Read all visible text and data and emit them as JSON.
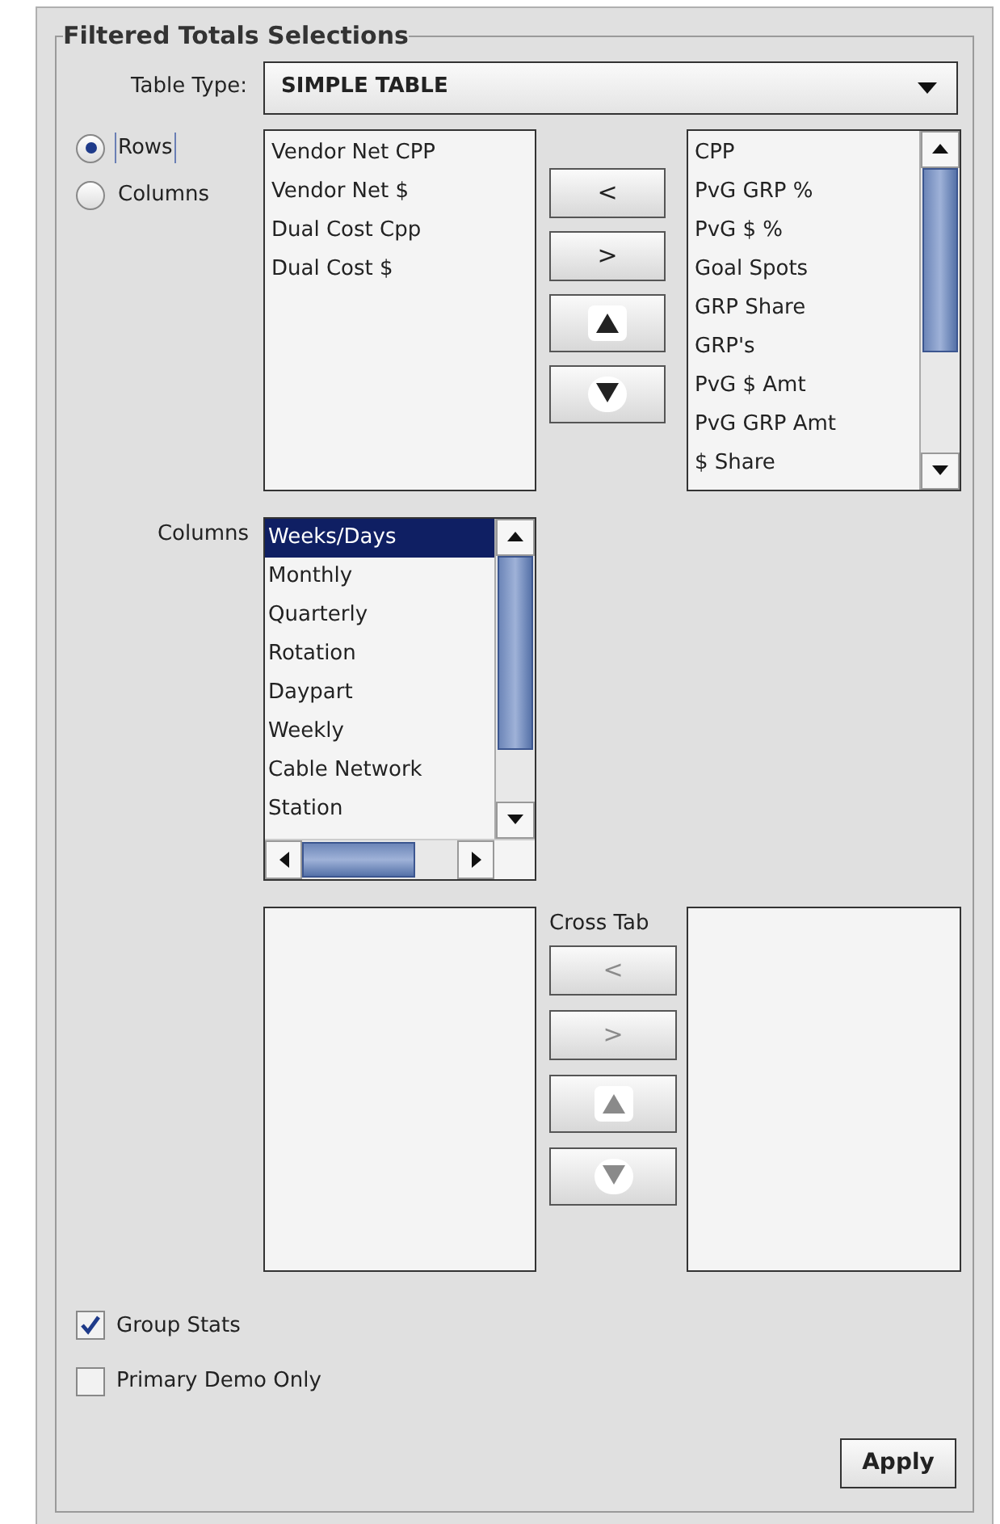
{
  "panel": {
    "title": "Filtered Totals Selections"
  },
  "table_type": {
    "label": "Table Type:",
    "value": "SIMPLE TABLE"
  },
  "orientation": [
    {
      "label": "Rows",
      "selected": true
    },
    {
      "label": "Columns",
      "selected": false
    }
  ],
  "selected_rows": [
    "Vendor Net CPP",
    "Vendor Net $",
    "Dual Cost Cpp",
    "Dual Cost $"
  ],
  "row_buttons": [
    {
      "kind": "text",
      "label": "<",
      "disabled": false
    },
    {
      "kind": "text",
      "label": ">",
      "disabled": false
    },
    {
      "kind": "up",
      "disabled": false
    },
    {
      "kind": "down",
      "disabled": false
    }
  ],
  "available_rows": [
    "CPP",
    "PvG GRP %",
    "PvG $ %",
    "Goal Spots",
    "GRP Share",
    "GRP's",
    "PvG $ Amt",
    "PvG GRP Amt",
    "$ Share"
  ],
  "columns": {
    "label": "Columns",
    "items": [
      {
        "label": "Weeks/Days",
        "selected": true
      },
      {
        "label": "Monthly",
        "selected": false
      },
      {
        "label": "Quarterly",
        "selected": false
      },
      {
        "label": "Rotation",
        "selected": false
      },
      {
        "label": "Daypart",
        "selected": false
      },
      {
        "label": "Weekly",
        "selected": false
      },
      {
        "label": "Cable Network",
        "selected": false
      },
      {
        "label": "Station",
        "selected": false
      }
    ]
  },
  "cross_tab": {
    "label": "Cross Tab",
    "buttons": [
      {
        "kind": "text",
        "label": "<",
        "disabled": true
      },
      {
        "kind": "text",
        "label": ">",
        "disabled": true
      },
      {
        "kind": "up",
        "disabled": true
      },
      {
        "kind": "down",
        "disabled": true
      }
    ]
  },
  "options": [
    {
      "label": "Group Stats",
      "checked": true
    },
    {
      "label": "Primary Demo Only",
      "checked": false
    }
  ],
  "apply_button": {
    "label": "Apply"
  }
}
